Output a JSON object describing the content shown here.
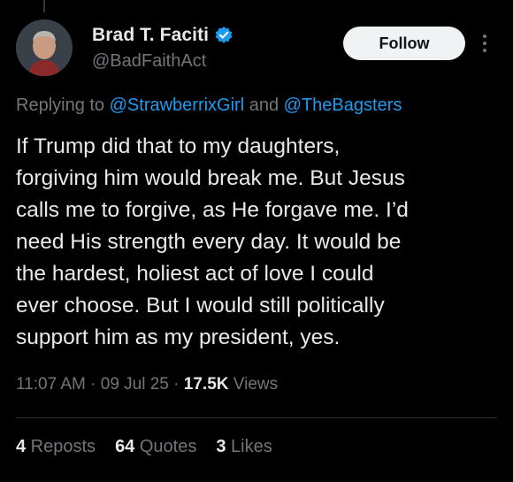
{
  "author": {
    "display_name": "Brad T. Faciti",
    "handle": "@BadFaithAct",
    "verified": true
  },
  "follow_label": "Follow",
  "reply": {
    "prefix": "Replying to ",
    "mention_1": "@StrawberrixGirl",
    "joiner": " and ",
    "mention_2": "@TheBagsters"
  },
  "tweet_text": "If Trump did that to my daughters,\nforgiving him would break me. But Jesus\ncalls me to forgive, as He forgave me. I’d\nneed His strength every day. It would be\nthe hardest, holiest act of love I could\never choose. But I would still politically\nsupport him as my president, yes.",
  "meta": {
    "time": "11:07 AM",
    "sep_1": " · ",
    "date": "09 Jul 25",
    "sep_2": " · ",
    "views_count": "17.5K",
    "views_label": " Views"
  },
  "stats": {
    "reposts_count": "4",
    "reposts_label": " Reposts",
    "quotes_count": "64",
    "quotes_label": " Quotes",
    "likes_count": "3",
    "likes_label": " Likes"
  },
  "colors": {
    "background": "#000000",
    "text": "#e7e9ea",
    "muted": "#71767b",
    "link": "#1d9bf0",
    "verified": "#1d9bf0"
  },
  "icons": {
    "verified": "verified-badge-icon",
    "more": "more-options-icon"
  }
}
